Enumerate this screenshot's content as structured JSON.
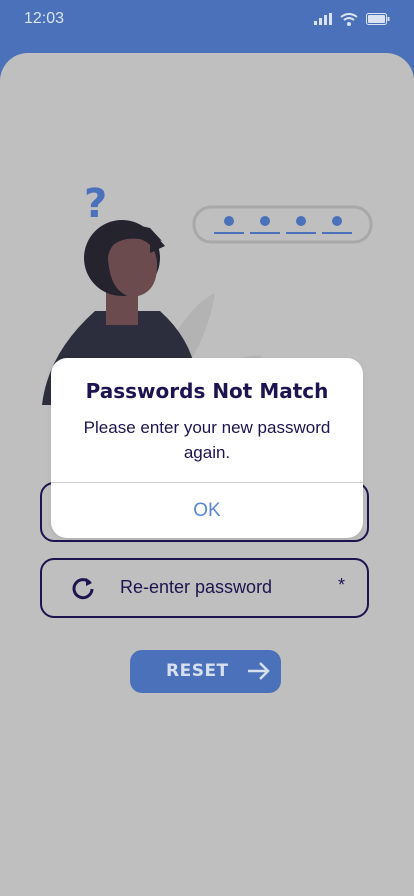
{
  "status_bar": {
    "time": "12:03"
  },
  "fields": [
    {
      "label": "Re-enter password",
      "required_mark": "*"
    }
  ],
  "reset": {
    "label": "RESET"
  },
  "dialog": {
    "title": "Passwords Not Match",
    "message": "Please enter your new password again.",
    "ok_label": "OK"
  },
  "illustration": {
    "question_mark": "?"
  },
  "colors": {
    "brand_blue": "#4a71b9",
    "navy": "#1d1450",
    "overlay_gray": "#bfbfbf",
    "ok_blue": "#5a86d6"
  }
}
